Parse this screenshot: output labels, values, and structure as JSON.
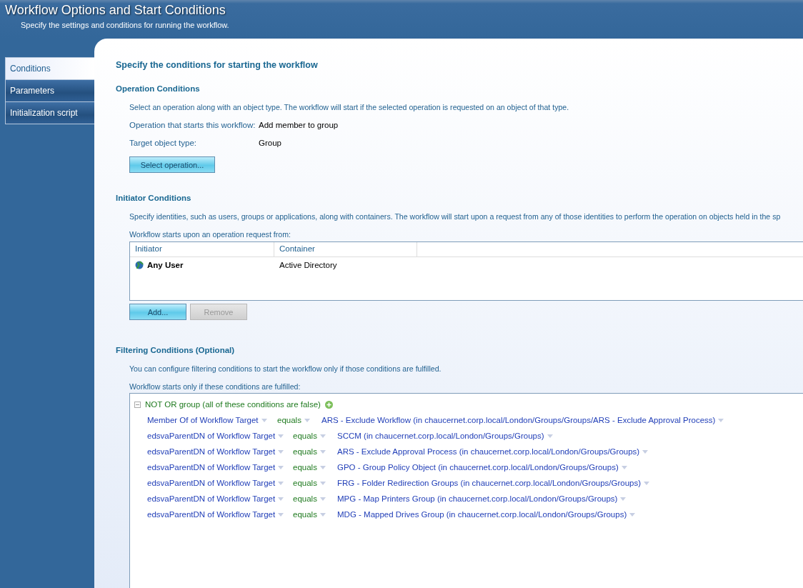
{
  "window": {
    "title": "Workflow Options and Start Conditions",
    "subtitle": "Specify the settings and conditions for running the workflow."
  },
  "sidebar": {
    "items": [
      {
        "label": "Conditions",
        "selected": true
      },
      {
        "label": "Parameters",
        "selected": false
      },
      {
        "label": "Initialization script",
        "selected": false
      }
    ]
  },
  "heading": "Specify the conditions for starting the workflow",
  "operation_conditions": {
    "title": "Operation Conditions",
    "description": "Select an operation along with an object type. The workflow will start if the selected operation is requested on an object of that type.",
    "fields": [
      {
        "label": "Operation that starts this workflow:",
        "value": "Add member to group"
      },
      {
        "label": "Target object type:",
        "value": "Group"
      }
    ],
    "button": {
      "label": "Select operation...",
      "disabled": false
    }
  },
  "initiator_conditions": {
    "title": "Initiator Conditions",
    "description": "Specify identities, such as users, groups or applications, along with containers. The workflow will start upon a request from any of those identities to perform the operation on objects held in the sp",
    "list_label": "Workflow starts upon an operation request from:",
    "table": {
      "columns": [
        "Initiator",
        "Container"
      ],
      "rows": [
        {
          "initiator": "Any User",
          "container": "Active Directory"
        }
      ]
    },
    "buttons": [
      {
        "label": "Add...",
        "disabled": false
      },
      {
        "label": "Remove",
        "disabled": true
      }
    ]
  },
  "filtering_conditions": {
    "title": "Filtering Conditions (Optional)",
    "description": "You can configure filtering conditions to start the workflow only if those conditions are fulfilled.",
    "list_label": "Workflow starts only if these conditions are fulfilled:",
    "group": {
      "label": "NOT OR group (all of these conditions are false)",
      "expanded": true,
      "conditions": [
        {
          "property": "Member Of of Workflow Target",
          "operator": "equals",
          "value": "ARS - Exclude Workflow (in chaucernet.corp.local/London/Groups/Groups/ARS - Exclude Approval Process)"
        },
        {
          "property": "edsvaParentDN of Workflow Target",
          "operator": "equals",
          "value": "SCCM (in chaucernet.corp.local/London/Groups/Groups)"
        },
        {
          "property": "edsvaParentDN of Workflow Target",
          "operator": "equals",
          "value": "ARS - Exclude Approval Process (in chaucernet.corp.local/London/Groups/Groups)"
        },
        {
          "property": "edsvaParentDN of Workflow Target",
          "operator": "equals",
          "value": "GPO - Group Policy Object (in chaucernet.corp.local/London/Groups/Groups)"
        },
        {
          "property": "edsvaParentDN of Workflow Target",
          "operator": "equals",
          "value": "FRG - Folder Redirection Groups (in chaucernet.corp.local/London/Groups/Groups)"
        },
        {
          "property": "edsvaParentDN of Workflow Target",
          "operator": "equals",
          "value": "MPG - Map Printers Group (in chaucernet.corp.local/London/Groups/Groups)"
        },
        {
          "property": "edsvaParentDN of Workflow Target",
          "operator": "equals",
          "value": "MDG - Mapped Drives Group (in chaucernet.corp.local/London/Groups/Groups)"
        }
      ]
    }
  }
}
